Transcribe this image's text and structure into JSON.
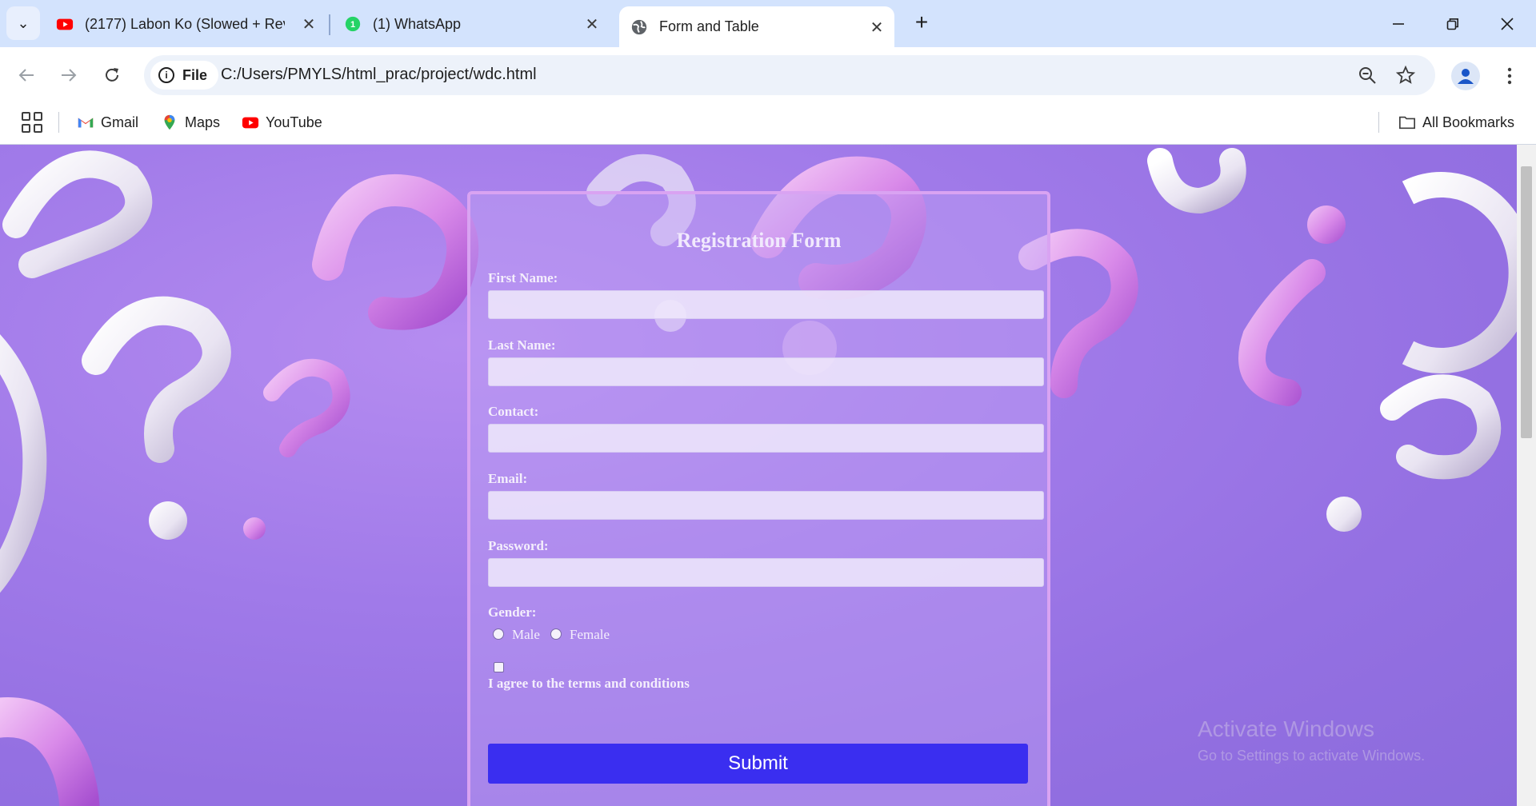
{
  "browser": {
    "tabs": [
      {
        "title": "(2177) Labon Ko (Slowed + Rev",
        "favicon": "youtube-icon",
        "close": "✕"
      },
      {
        "title": "(1) WhatsApp",
        "favicon": "whatsapp-icon",
        "close": "✕"
      },
      {
        "title": "Form and Table",
        "favicon": "globe-icon",
        "close": "✕",
        "active": true
      }
    ],
    "new_tab": "+",
    "omnibox": {
      "chip_label": "File",
      "url": "C:/Users/PMYLS/html_prac/project/wdc.html"
    },
    "bookmarks": [
      {
        "label": "Gmail",
        "icon": "gmail-icon"
      },
      {
        "label": "Maps",
        "icon": "maps-icon"
      },
      {
        "label": "YouTube",
        "icon": "youtube-icon"
      }
    ],
    "all_bookmarks": "All Bookmarks"
  },
  "form": {
    "title": "Registration Form",
    "fields": [
      {
        "label": "First Name:",
        "value": ""
      },
      {
        "label": "Last Name:",
        "value": ""
      },
      {
        "label": "Contact:",
        "value": ""
      },
      {
        "label": "Email:",
        "value": ""
      },
      {
        "label": "Password:",
        "value": ""
      }
    ],
    "gender_label": "Gender:",
    "gender_options": [
      "Male",
      "Female"
    ],
    "terms_label": "I agree to the terms and conditions",
    "submit_label": "Submit"
  },
  "watermark": {
    "line1": "Activate Windows",
    "line2": "Go to Settings to activate Windows."
  },
  "colors": {
    "tabstrip": "#d3e3fd",
    "submit": "#3a2ef0",
    "form_border": "#d9a3f2",
    "background": "#a07ae9"
  }
}
